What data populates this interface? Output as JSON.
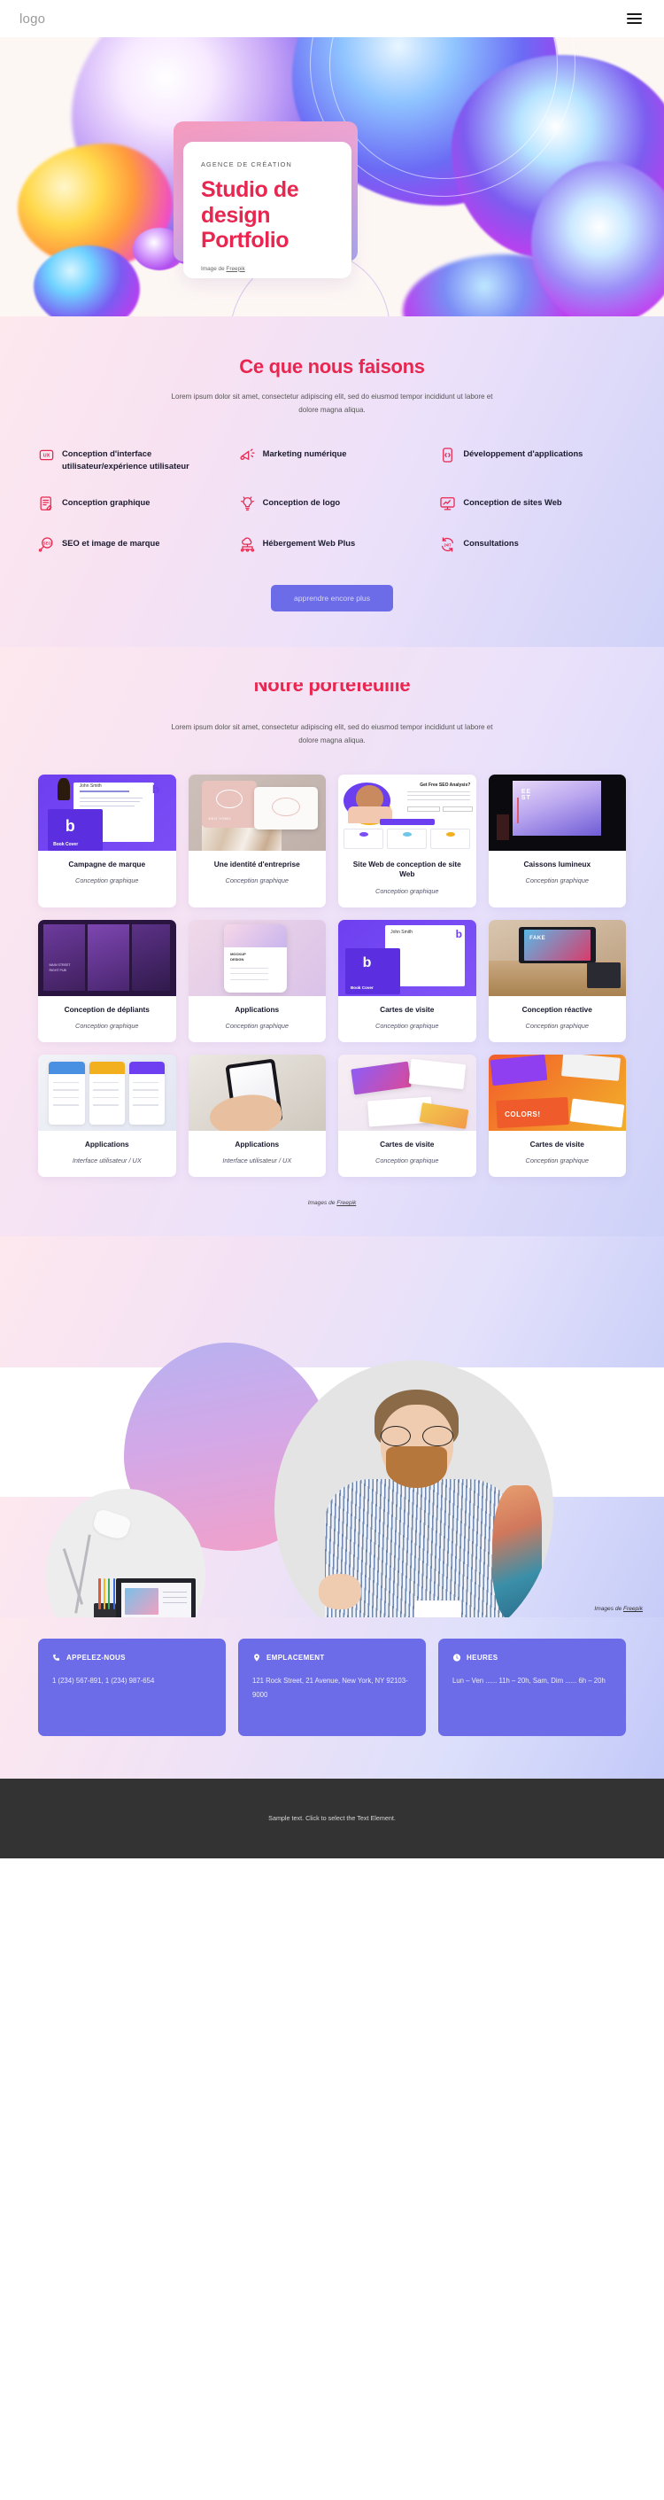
{
  "header": {
    "logo": "logo",
    "menu_icon": "hamburger-menu-icon"
  },
  "hero": {
    "eyebrow": "AGENCE DE CRÉATION",
    "title_line1": "Studio de",
    "title_line2": "design",
    "title_line3": "Portfolio",
    "credit_prefix": "Image de ",
    "credit_link": "Freepik"
  },
  "services": {
    "title": "Ce que nous faisons",
    "subtitle": "Lorem ipsum dolor sit amet, consectetur adipiscing elit, sed do eiusmod tempor incididunt ut labore et dolore magna aliqua.",
    "items": [
      {
        "label": "Conception d'interface utilisateur/expérience utilisateur",
        "icon": "ux-badge-icon"
      },
      {
        "label": "Marketing numérique",
        "icon": "megaphone-icon"
      },
      {
        "label": "Développement d'applications",
        "icon": "mobile-code-icon"
      },
      {
        "label": "Conception graphique",
        "icon": "document-pen-icon"
      },
      {
        "label": "Conception de logo",
        "icon": "lightbulb-icon"
      },
      {
        "label": "Conception de sites Web",
        "icon": "monitor-chart-icon"
      },
      {
        "label": "SEO et image de marque",
        "icon": "seo-magnifier-icon"
      },
      {
        "label": "Hébergement Web Plus",
        "icon": "cloud-network-icon"
      },
      {
        "label": "Consultations",
        "icon": "247-refresh-icon"
      }
    ],
    "cta": "apprendre encore plus"
  },
  "portfolio": {
    "title": "Notre portefeuille",
    "subtitle": "Lorem ipsum dolor sit amet, consectetur adipiscing elit, sed do eiusmod tempor incididunt ut labore et dolore magna aliqua.",
    "items": [
      {
        "name": "Campagne de marque",
        "category": "Conception graphique"
      },
      {
        "name": "Une identité d'entreprise",
        "category": "Conception graphique"
      },
      {
        "name": "Site Web de conception de site Web",
        "category": "Conception graphique"
      },
      {
        "name": "Caissons lumineux",
        "category": "Conception graphique"
      },
      {
        "name": "Conception de dépliants",
        "category": "Conception graphique"
      },
      {
        "name": "Applications",
        "category": "Conception graphique"
      },
      {
        "name": "Cartes de visite",
        "category": "Conception graphique"
      },
      {
        "name": "Conception réactive",
        "category": "Conception graphique"
      },
      {
        "name": "Applications",
        "category": "Interface utilisateur / UX"
      },
      {
        "name": "Applications",
        "category": "Interface utilisateur / UX"
      },
      {
        "name": "Cartes de visite",
        "category": "Conception graphique"
      },
      {
        "name": "Cartes de visite",
        "category": "Conception graphique"
      }
    ],
    "credit_prefix": "Images de ",
    "credit_link": "Freepik"
  },
  "photos": {
    "credit_prefix": "Images de ",
    "credit_link": "Freepik"
  },
  "contact": {
    "cards": [
      {
        "title": "APPELEZ-NOUS",
        "icon": "phone-icon",
        "body": "1 (234) 567-891,\n1 (234) 987-654"
      },
      {
        "title": "EMPLACEMENT",
        "icon": "map-pin-icon",
        "body": "121 Rock Street, 21 Avenue, New York, NY 92103-9000"
      },
      {
        "title": "HEURES",
        "icon": "clock-icon",
        "body": "Lun – Ven ...... 11h – 20h, Sam, Dim  ...... 6h – 20h"
      }
    ]
  },
  "footer": {
    "text": "Sample text. Click to select the Text Element."
  },
  "colors": {
    "accent_pink": "#e8264f",
    "accent_purple": "#6c6ce8",
    "footer_bg": "#333333"
  }
}
